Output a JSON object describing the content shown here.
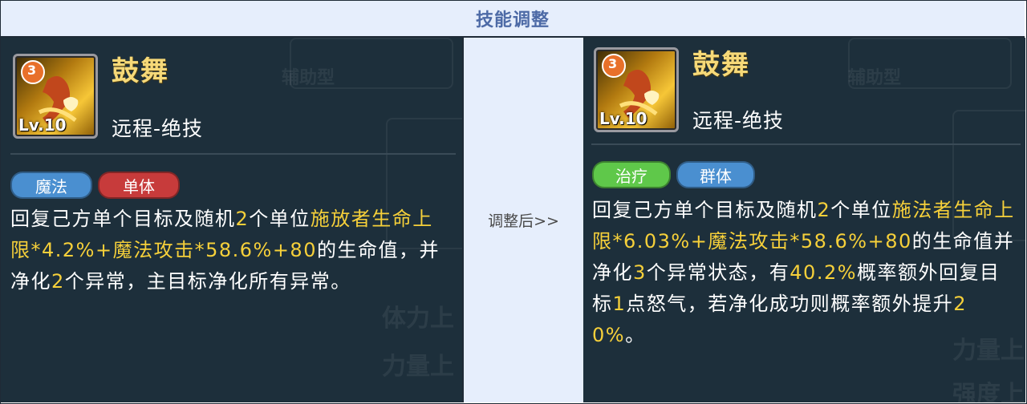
{
  "header": {
    "title": "技能调整"
  },
  "divider": {
    "label": "调整后>>"
  },
  "colors": {
    "highlight": "#f6d03a",
    "tag_magic": "#4a8fd0",
    "tag_single": "#c73b3b",
    "tag_heal": "#5fc84a",
    "tag_group": "#4a8fd0"
  },
  "before": {
    "icon": "skill-icon-dance-monkey",
    "level": "Lv.10",
    "badge": "3",
    "name": "鼓舞",
    "type": "远程-绝技",
    "tags": [
      "魔法",
      "单体"
    ],
    "desc": [
      {
        "t": "回复己方单个目标及随机",
        "h": false
      },
      {
        "t": "2",
        "h": true
      },
      {
        "t": "个单位",
        "h": false
      },
      {
        "t": "施放者生命上限*4.2%+魔法攻击*58.6%+80",
        "h": true
      },
      {
        "t": "的生命值，并净化",
        "h": false
      },
      {
        "t": "2",
        "h": true
      },
      {
        "t": "个异常，主目标净化所有异常。",
        "h": false
      }
    ]
  },
  "after": {
    "icon": "skill-icon-dance-monkey",
    "level": "Lv.10",
    "badge": "3",
    "name": "鼓舞",
    "type": "远程-绝技",
    "tags": [
      "治疗",
      "群体"
    ],
    "desc": [
      {
        "t": "回复己方单个目标及随机",
        "h": false
      },
      {
        "t": "2",
        "h": true
      },
      {
        "t": "个单位",
        "h": false
      },
      {
        "t": "施法者生命上限*6.03%+魔法攻击*58.6%+80",
        "h": true
      },
      {
        "t": "的生命值并净化",
        "h": false
      },
      {
        "t": "3",
        "h": true
      },
      {
        "t": "个异常状态，有",
        "h": false
      },
      {
        "t": "40.2%",
        "h": true
      },
      {
        "t": "概率额外回复目标",
        "h": false
      },
      {
        "t": "1",
        "h": true
      },
      {
        "t": "点怒气，若净化成功则概率额外提升",
        "h": false
      },
      {
        "t": "20%",
        "h": true
      },
      {
        "t": "。",
        "h": false
      }
    ]
  },
  "background_ghost_text": [
    "辅助型",
    "体力上",
    "力量上",
    "强度上"
  ]
}
